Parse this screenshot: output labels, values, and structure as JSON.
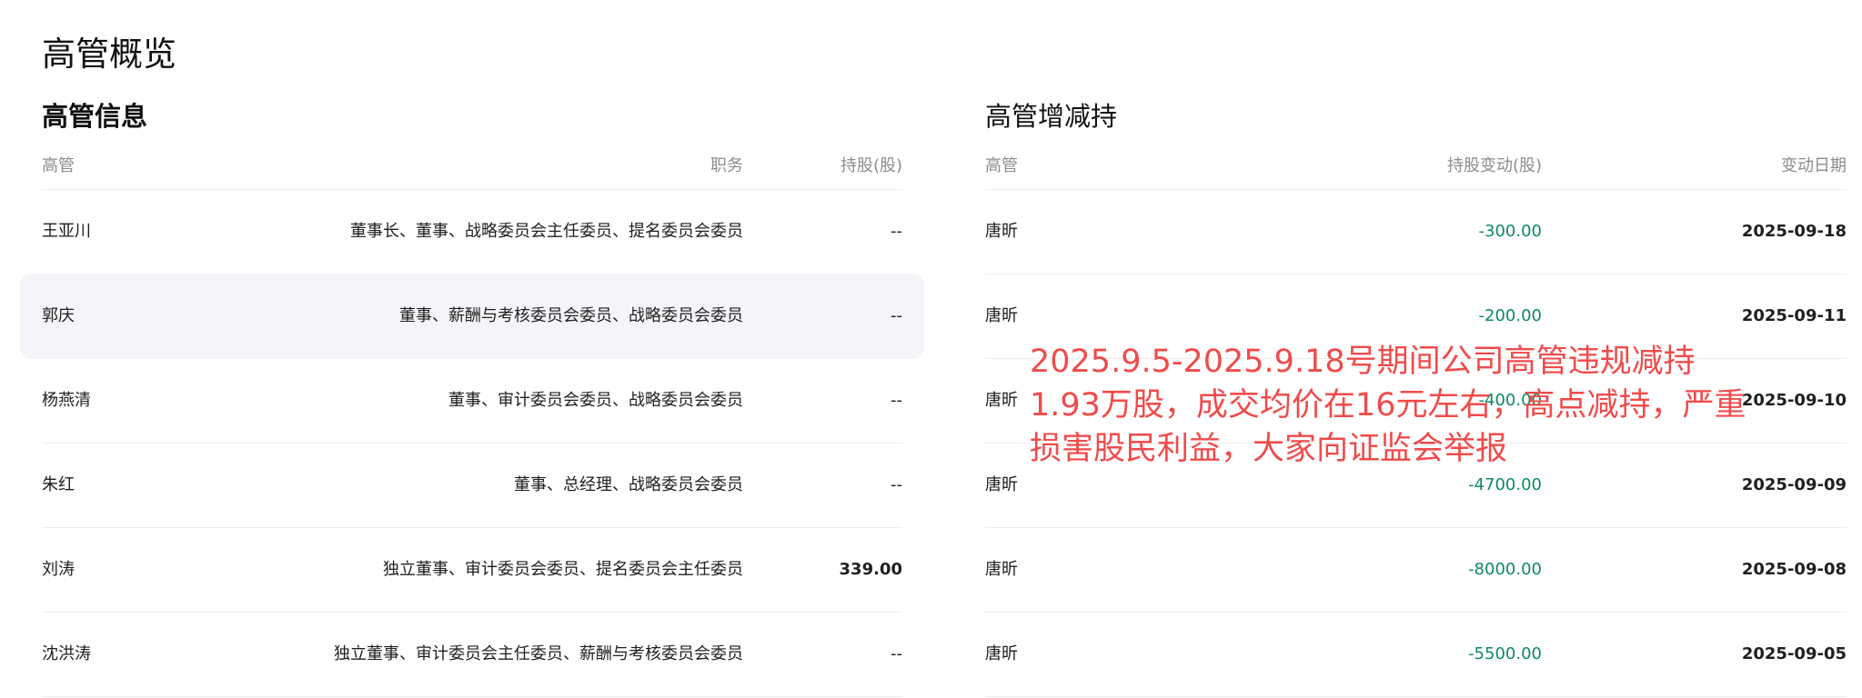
{
  "page_title": "高管概览",
  "exec_info": {
    "title": "高管信息",
    "headers": {
      "name": "高管",
      "role": "职务",
      "shares": "持股(股)"
    },
    "rows": [
      {
        "name": "王亚川",
        "role": "董事长、董事、战略委员会主任委员、提名委员会委员",
        "shares": "--"
      },
      {
        "name": "郭庆",
        "role": "董事、薪酬与考核委员会委员、战略委员会委员",
        "shares": "--"
      },
      {
        "name": "杨燕清",
        "role": "董事、审计委员会委员、战略委员会委员",
        "shares": "--"
      },
      {
        "name": "朱红",
        "role": "董事、总经理、战略委员会委员",
        "shares": "--"
      },
      {
        "name": "刘涛",
        "role": "独立董事、审计委员会委员、提名委员会主任委员",
        "shares": "339.00"
      },
      {
        "name": "沈洪涛",
        "role": "独立董事、审计委员会主任委员、薪酬与考核委员会委员",
        "shares": "--"
      }
    ]
  },
  "exec_changes": {
    "title": "高管增减持",
    "headers": {
      "name": "高管",
      "change": "持股变动(股)",
      "date": "变动日期"
    },
    "rows": [
      {
        "name": "唐昕",
        "change": "-300.00",
        "date": "2025-09-18"
      },
      {
        "name": "唐昕",
        "change": "-200.00",
        "date": "2025-09-11"
      },
      {
        "name": "唐昕",
        "change": "-400.00",
        "date": "2025-09-10"
      },
      {
        "name": "唐昕",
        "change": "-4700.00",
        "date": "2025-09-09"
      },
      {
        "name": "唐昕",
        "change": "-8000.00",
        "date": "2025-09-08"
      },
      {
        "name": "唐昕",
        "change": "-5500.00",
        "date": "2025-09-05"
      }
    ]
  },
  "annotation_text": "2025.9.5-2025.9.18号期间公司高管违规减持1.93万股，成交均价在16元左右，高点减持，严重损害股民利益，大家向证监会举报",
  "colors": {
    "negative_change": "#0f8a5f",
    "annotation": "#f04b4b",
    "row_highlight": "#f4f5f8"
  }
}
